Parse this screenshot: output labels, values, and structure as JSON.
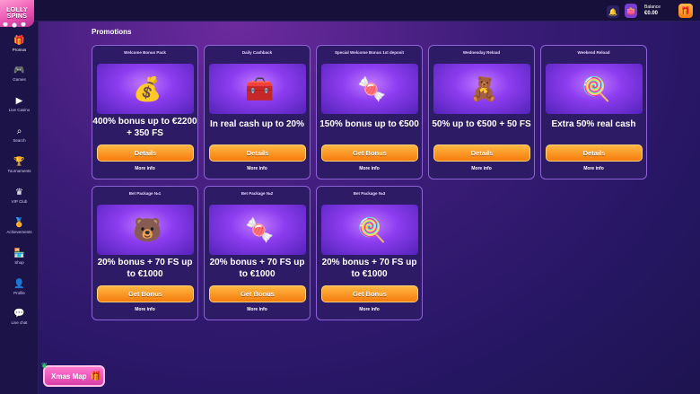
{
  "app": {
    "logo_line1": "LOLLY",
    "logo_line2": "SPINS"
  },
  "header": {
    "balance_label": "Balance",
    "balance_value": "€0.00",
    "bell_icon": "bell-icon",
    "wallet_icon": "wallet-icon",
    "gift_icon": "gift-icon"
  },
  "sidebar": {
    "items": [
      {
        "label": "Promos",
        "icon": "gift-icon"
      },
      {
        "label": "Games",
        "icon": "gamepad-icon"
      },
      {
        "label": "Live Casino",
        "icon": "play-icon"
      },
      {
        "label": "Search",
        "icon": "search-icon"
      },
      {
        "label": "Tournaments",
        "icon": "trophy-icon"
      },
      {
        "label": "VIP Club",
        "icon": "crown-icon"
      },
      {
        "label": "Achievements",
        "icon": "medal-icon"
      },
      {
        "label": "Shop",
        "icon": "shop-icon"
      },
      {
        "label": "Profile",
        "icon": "user-icon"
      },
      {
        "label": "Live chat",
        "icon": "chat-icon"
      }
    ]
  },
  "page": {
    "title": "Promotions"
  },
  "cards": [
    {
      "title": "Welcome Bonus Pack",
      "headline": "400% bonus up to €2200 + 350 FS",
      "button": "Details",
      "more": "More info"
    },
    {
      "title": "Daily Cashback",
      "headline": "In real cash up to 20%",
      "button": "Details",
      "more": "More info"
    },
    {
      "title": "Special Welcome Bonus 1st deposit",
      "headline": "150% bonus up to €500",
      "button": "Get Bonus",
      "more": "More info"
    },
    {
      "title": "Wednesday Reload",
      "headline": "50% up to €500 + 50 FS",
      "button": "Details",
      "more": "More info"
    },
    {
      "title": "Weekend Reload",
      "headline": "Extra 50% real cash",
      "button": "Details",
      "more": "More info"
    },
    {
      "title": "Bet Package №1",
      "headline": "20% bonus + 70 FS up to €1000",
      "button": "Get Bonus",
      "more": "More info"
    },
    {
      "title": "Bet Package №2",
      "headline": "20% bonus + 70 FS up to €1000",
      "button": "Get Bonus",
      "more": "More info"
    },
    {
      "title": "Bet Package №3",
      "headline": "20% bonus + 70 FS up to €1000",
      "button": "Get Bonus",
      "more": "More info"
    }
  ],
  "xmas_map": {
    "label": "Xmas Map"
  },
  "colors": {
    "accent_orange": "#f67c0d",
    "card_border": "#8e63d8",
    "background": "#1a1240"
  }
}
